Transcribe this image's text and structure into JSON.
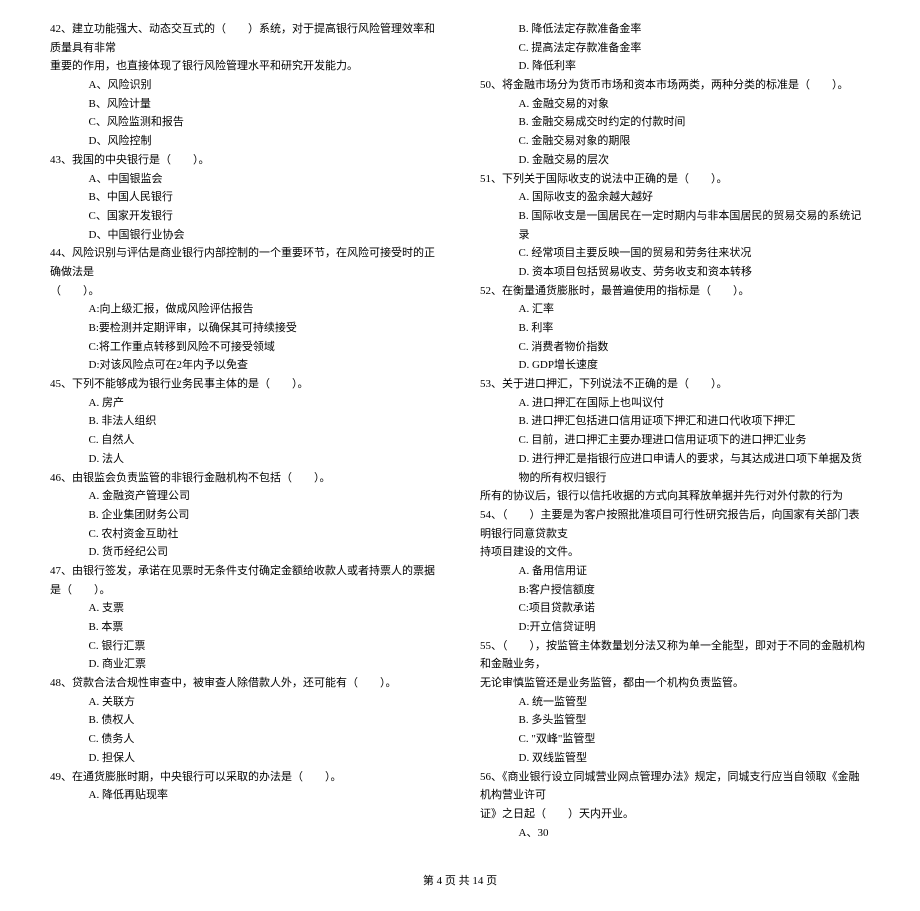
{
  "leftColumn": {
    "q42": {
      "line1": "42、建立功能强大、动态交互式的（　　）系统，对于提高银行风险管理效率和质量具有非常",
      "line2": "重要的作用，也直接体现了银行风险管理水平和研究开发能力。",
      "A": "A、风险识别",
      "B": "B、风险计量",
      "C": "C、风险监测和报告",
      "D": "D、风险控制"
    },
    "q43": {
      "text": "43、我国的中央银行是（　　）。",
      "A": "A、中国银监会",
      "B": "B、中国人民银行",
      "C": "C、国家开发银行",
      "D": "D、中国银行业协会"
    },
    "q44": {
      "line1": "44、风险识别与评估是商业银行内部控制的一个重要环节，在风险可接受时的正确做法是",
      "line2": "（　　）。",
      "A": "A:向上级汇报，做成风险评估报告",
      "B": "B:要检测并定期评审，以确保其可持续接受",
      "C": "C:将工作重点转移到风险不可接受领域",
      "D": "D:对该风险点可在2年内予以免查"
    },
    "q45": {
      "text": "45、下列不能够成为银行业务民事主体的是（　　）。",
      "A": "A. 房产",
      "B": "B. 非法人组织",
      "C": "C. 自然人",
      "D": "D. 法人"
    },
    "q46": {
      "text": "46、由银监会负责监管的非银行金融机构不包括（　　）。",
      "A": "A. 金融资产管理公司",
      "B": "B. 企业集团财务公司",
      "C": "C. 农村资金互助社",
      "D": "D. 货币经纪公司"
    },
    "q47": {
      "text": "47、由银行签发，承诺在见票时无条件支付确定金额给收款人或者持票人的票据是（　　）。",
      "A": "A. 支票",
      "B": "B. 本票",
      "C": "C. 银行汇票",
      "D": "D. 商业汇票"
    },
    "q48": {
      "text": "48、贷款合法合规性审查中，被审查人除借款人外，还可能有（　　）。",
      "A": "A. 关联方",
      "B": "B. 债权人",
      "C": "C. 债务人",
      "D": "D. 担保人"
    },
    "q49": {
      "text": "49、在通货膨胀时期，中央银行可以采取的办法是（　　）。",
      "A": "A. 降低再贴现率"
    }
  },
  "rightColumn": {
    "q49cont": {
      "B": "B. 降低法定存款准备金率",
      "C": "C. 提高法定存款准备金率",
      "D": "D. 降低利率"
    },
    "q50": {
      "text": "50、将金融市场分为货币市场和资本市场两类，两种分类的标准是（　　）。",
      "A": "A. 金融交易的对象",
      "B": "B. 金融交易成交时约定的付款时间",
      "C": "C. 金融交易对象的期限",
      "D": "D. 金融交易的层次"
    },
    "q51": {
      "text": "51、下列关于国际收支的说法中正确的是（　　）。",
      "A": "A. 国际收支的盈余越大越好",
      "B": "B. 国际收支是一国居民在一定时期内与非本国居民的贸易交易的系统记录",
      "C": "C. 经常项目主要反映一国的贸易和劳务往来状况",
      "D": "D. 资本项目包括贸易收支、劳务收支和资本转移"
    },
    "q52": {
      "text": "52、在衡量通货膨胀时，最普遍使用的指标是（　　）。",
      "A": "A. 汇率",
      "B": "B. 利率",
      "C": "C. 消费者物价指数",
      "D": "D. GDP增长速度"
    },
    "q53": {
      "text": "53、关于进口押汇，下列说法不正确的是（　　）。",
      "A": "A. 进口押汇在国际上也叫议付",
      "B": "B. 进口押汇包括进口信用证项下押汇和进口代收项下押汇",
      "C": "C. 目前，进口押汇主要办理进口信用证项下的进口押汇业务",
      "Dline1": "D. 进行押汇是指银行应进口申请人的要求，与其达成进口项下单据及货物的所有权归银行",
      "Dline2": "所有的协议后，银行以信托收据的方式向其释放单据并先行对外付款的行为"
    },
    "q54": {
      "line1": "54、（　　）主要是为客户按照批准项目可行性研究报告后，向国家有关部门表明银行同意贷款支",
      "line2": "持项目建设的文件。",
      "A": "A. 备用信用证",
      "B": "B:客户授信额度",
      "C": "C:项目贷款承诺",
      "D": "D:开立信贷证明"
    },
    "q55": {
      "line1": "55、（　　），按监管主体数量划分法又称为单一全能型，即对于不同的金融机构和金融业务，",
      "line2": "无论审慎监管还是业务监管，都由一个机构负责监管。",
      "A": "A. 统一监管型",
      "B": "B. 多头监管型",
      "C": "C. \"双峰\"监管型",
      "D": "D. 双线监管型"
    },
    "q56": {
      "line1": "56、《商业银行设立同城营业网点管理办法》规定，同城支行应当自领取《金融机构营业许可",
      "line2": "证》之日起（　　）天内开业。",
      "A": "A、30"
    }
  },
  "footer": "第 4 页 共 14 页"
}
